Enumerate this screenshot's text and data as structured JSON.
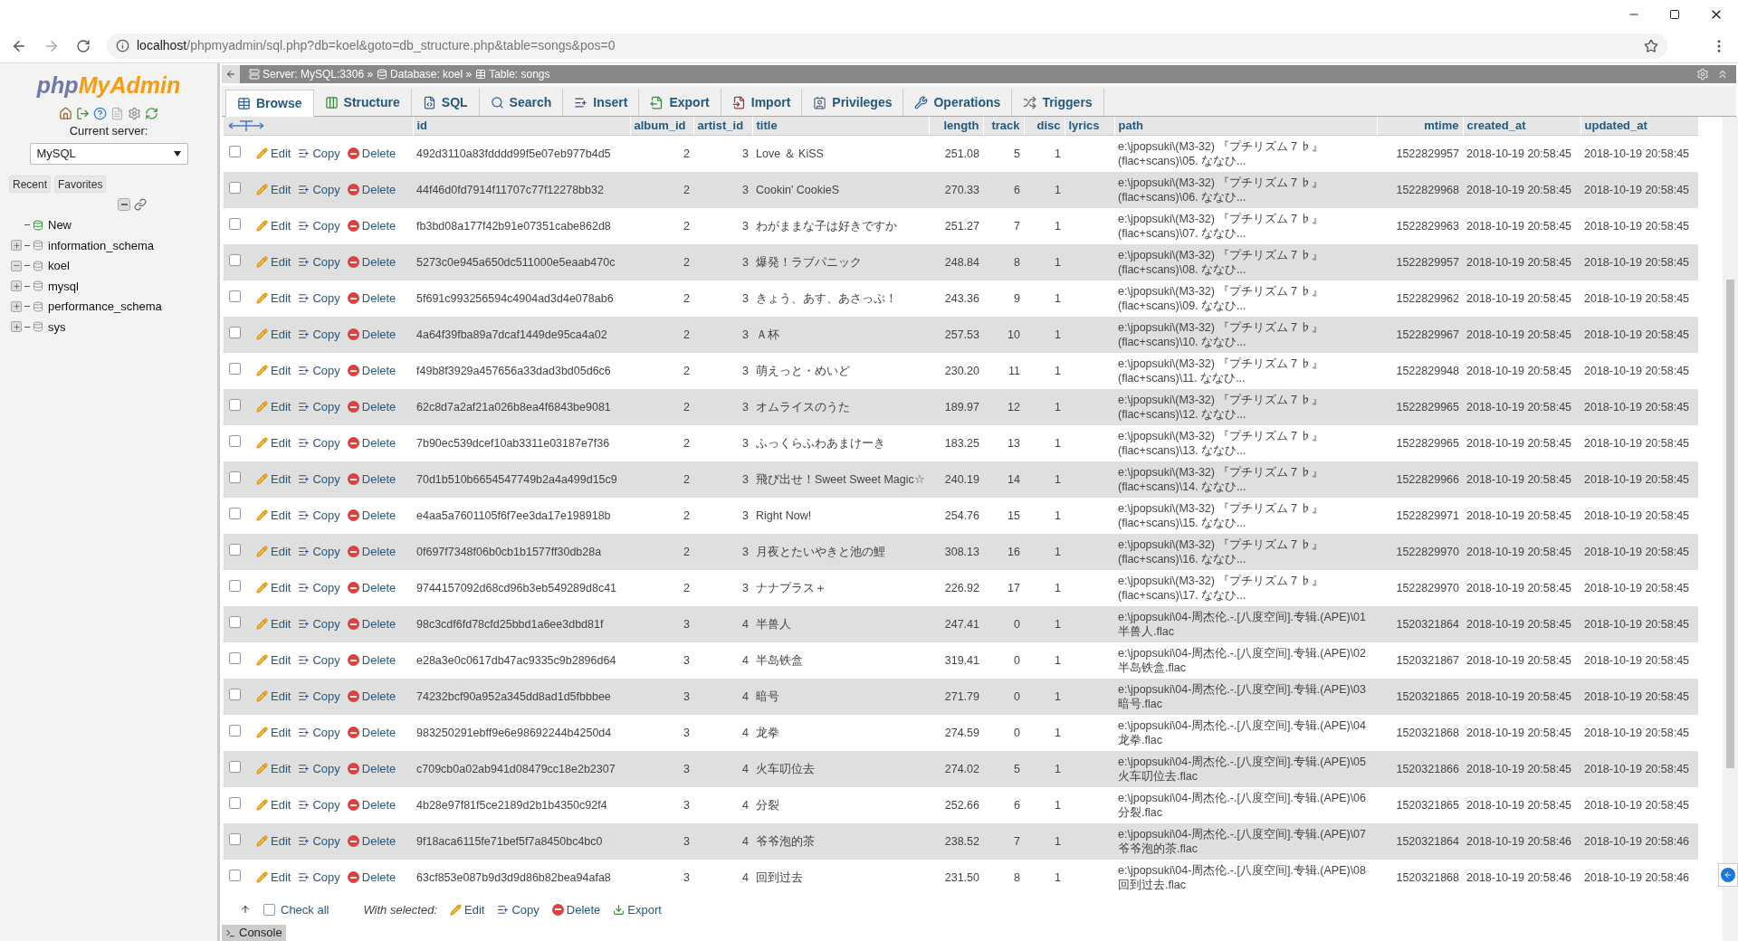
{
  "browser": {
    "url_host": "localhost",
    "url_rest": "/phpmyadmin/sql.php?db=koel&goto=db_structure.php&table=songs&pos=0"
  },
  "sidebar": {
    "logo_a": "php",
    "logo_b": "MyAdmin",
    "server_label": "Current server:",
    "server_value": "MySQL",
    "buttons": [
      "Recent",
      "Favorites"
    ],
    "tree": [
      {
        "kind": "new",
        "label": "New"
      },
      {
        "kind": "db",
        "label": "information_schema",
        "expanded": false
      },
      {
        "kind": "db",
        "label": "koel",
        "expanded": true
      },
      {
        "kind": "db",
        "label": "mysql",
        "expanded": false
      },
      {
        "kind": "db",
        "label": "performance_schema",
        "expanded": false
      },
      {
        "kind": "db",
        "label": "sys",
        "expanded": false
      }
    ]
  },
  "breadcrumb": [
    {
      "kind": "server",
      "label": "Server: MySQL:3306 »"
    },
    {
      "kind": "database",
      "label": "Database: koel »"
    },
    {
      "kind": "table",
      "label": "Table: songs"
    }
  ],
  "tabs": [
    {
      "kind": "browse",
      "label": "Browse",
      "selected": true
    },
    {
      "kind": "structure",
      "label": "Structure",
      "selected": false
    },
    {
      "kind": "sql",
      "label": "SQL",
      "selected": false
    },
    {
      "kind": "search",
      "label": "Search",
      "selected": false
    },
    {
      "kind": "insert",
      "label": "Insert",
      "selected": false
    },
    {
      "kind": "export",
      "label": "Export",
      "selected": false
    },
    {
      "kind": "import",
      "label": "Import",
      "selected": false
    },
    {
      "kind": "privileges",
      "label": "Privileges",
      "selected": false
    },
    {
      "kind": "operations",
      "label": "Operations",
      "selected": false
    },
    {
      "kind": "triggers",
      "label": "Triggers",
      "selected": false
    }
  ],
  "table": {
    "columns": [
      "id",
      "album_id",
      "artist_id",
      "title",
      "length",
      "track",
      "disc",
      "lyrics",
      "path",
      "mtime",
      "created_at",
      "updated_at"
    ],
    "rows": [
      {
        "checked": false,
        "actions": [
          {
            "kind": "edit",
            "label": "Edit"
          },
          {
            "kind": "copy",
            "label": "Copy"
          },
          {
            "kind": "delete",
            "label": "Delete"
          }
        ],
        "id": "492d3110a83fdddd99f5e07eb977b4d5",
        "album_id": "2",
        "artist_id": "3",
        "title": "Love ＆ KiSS",
        "length": "251.08",
        "track": "5",
        "disc": "1",
        "path": "e:\\jpopsuki\\(M3-32) 『プチリズム７♭』(flac+scans)\\05. ななひ...",
        "mtime": "1522829957",
        "created_at": "2018-10-19 20:58:45",
        "updated_at": "2018-10-19 20:58:45"
      },
      {
        "checked": false,
        "actions": [
          {
            "kind": "edit",
            "label": "Edit"
          },
          {
            "kind": "copy",
            "label": "Copy"
          },
          {
            "kind": "delete",
            "label": "Delete"
          }
        ],
        "id": "44f46d0fd7914f11707c77f12278bb32",
        "album_id": "2",
        "artist_id": "3",
        "title": "Cookin' CookieS",
        "length": "270.33",
        "track": "6",
        "disc": "1",
        "path": "e:\\jpopsuki\\(M3-32) 『プチリズム７♭』(flac+scans)\\06. ななひ...",
        "mtime": "1522829968",
        "created_at": "2018-10-19 20:58:45",
        "updated_at": "2018-10-19 20:58:45"
      },
      {
        "checked": false,
        "actions": [
          {
            "kind": "edit",
            "label": "Edit"
          },
          {
            "kind": "copy",
            "label": "Copy"
          },
          {
            "kind": "delete",
            "label": "Delete"
          }
        ],
        "id": "fb3bd08a177f42b91e07351cabe862d8",
        "album_id": "2",
        "artist_id": "3",
        "title": "わがままな子は好きですか",
        "length": "251.27",
        "track": "7",
        "disc": "1",
        "path": "e:\\jpopsuki\\(M3-32) 『プチリズム７♭』(flac+scans)\\07. ななひ...",
        "mtime": "1522829963",
        "created_at": "2018-10-19 20:58:45",
        "updated_at": "2018-10-19 20:58:45"
      },
      {
        "checked": false,
        "actions": [
          {
            "kind": "edit",
            "label": "Edit"
          },
          {
            "kind": "copy",
            "label": "Copy"
          },
          {
            "kind": "delete",
            "label": "Delete"
          }
        ],
        "id": "5273c0e945a650dc511000e5eaab470c",
        "album_id": "2",
        "artist_id": "3",
        "title": "爆発！ラブパニック",
        "length": "248.84",
        "track": "8",
        "disc": "1",
        "path": "e:\\jpopsuki\\(M3-32) 『プチリズム７♭』(flac+scans)\\08. ななひ...",
        "mtime": "1522829957",
        "created_at": "2018-10-19 20:58:45",
        "updated_at": "2018-10-19 20:58:45"
      },
      {
        "checked": false,
        "actions": [
          {
            "kind": "edit",
            "label": "Edit"
          },
          {
            "kind": "copy",
            "label": "Copy"
          },
          {
            "kind": "delete",
            "label": "Delete"
          }
        ],
        "id": "5f691c993256594c4904ad3d4e078ab6",
        "album_id": "2",
        "artist_id": "3",
        "title": "きょう、あす、あさっぷ！",
        "length": "243.36",
        "track": "9",
        "disc": "1",
        "path": "e:\\jpopsuki\\(M3-32) 『プチリズム７♭』(flac+scans)\\09. ななひ...",
        "mtime": "1522829962",
        "created_at": "2018-10-19 20:58:45",
        "updated_at": "2018-10-19 20:58:45"
      },
      {
        "checked": false,
        "actions": [
          {
            "kind": "edit",
            "label": "Edit"
          },
          {
            "kind": "copy",
            "label": "Copy"
          },
          {
            "kind": "delete",
            "label": "Delete"
          }
        ],
        "id": "4a64f39fba89a7dcaf1449de95ca4a02",
        "album_id": "2",
        "artist_id": "3",
        "title": "Ａ杯",
        "length": "257.53",
        "track": "10",
        "disc": "1",
        "path": "e:\\jpopsuki\\(M3-32) 『プチリズム７♭』(flac+scans)\\10. ななひ...",
        "mtime": "1522829967",
        "created_at": "2018-10-19 20:58:45",
        "updated_at": "2018-10-19 20:58:45"
      },
      {
        "checked": false,
        "actions": [
          {
            "kind": "edit",
            "label": "Edit"
          },
          {
            "kind": "copy",
            "label": "Copy"
          },
          {
            "kind": "delete",
            "label": "Delete"
          }
        ],
        "id": "f49b8f3929a457656a33dad3bd05d6c6",
        "album_id": "2",
        "artist_id": "3",
        "title": "萌えっと・めいど",
        "length": "230.20",
        "track": "11",
        "disc": "1",
        "path": "e:\\jpopsuki\\(M3-32) 『プチリズム７♭』(flac+scans)\\11. ななひ...",
        "mtime": "1522829948",
        "created_at": "2018-10-19 20:58:45",
        "updated_at": "2018-10-19 20:58:45"
      },
      {
        "checked": false,
        "actions": [
          {
            "kind": "edit",
            "label": "Edit"
          },
          {
            "kind": "copy",
            "label": "Copy"
          },
          {
            "kind": "delete",
            "label": "Delete"
          }
        ],
        "id": "62c8d7a2af21a026b8ea4f6843be9081",
        "album_id": "2",
        "artist_id": "3",
        "title": "オムライスのうた",
        "length": "189.97",
        "track": "12",
        "disc": "1",
        "path": "e:\\jpopsuki\\(M3-32) 『プチリズム７♭』(flac+scans)\\12. ななひ...",
        "mtime": "1522829965",
        "created_at": "2018-10-19 20:58:45",
        "updated_at": "2018-10-19 20:58:45"
      },
      {
        "checked": false,
        "actions": [
          {
            "kind": "edit",
            "label": "Edit"
          },
          {
            "kind": "copy",
            "label": "Copy"
          },
          {
            "kind": "delete",
            "label": "Delete"
          }
        ],
        "id": "7b90ec539dcef10ab3311e03187e7f36",
        "album_id": "2",
        "artist_id": "3",
        "title": "ふっくらふわあまけーき",
        "length": "183.25",
        "track": "13",
        "disc": "1",
        "path": "e:\\jpopsuki\\(M3-32) 『プチリズム７♭』(flac+scans)\\13. ななひ...",
        "mtime": "1522829965",
        "created_at": "2018-10-19 20:58:45",
        "updated_at": "2018-10-19 20:58:45"
      },
      {
        "checked": false,
        "actions": [
          {
            "kind": "edit",
            "label": "Edit"
          },
          {
            "kind": "copy",
            "label": "Copy"
          },
          {
            "kind": "delete",
            "label": "Delete"
          }
        ],
        "id": "70d1b510b6654547749b2a4a499d15c9",
        "album_id": "2",
        "artist_id": "3",
        "title": "飛び出せ！Sweet Sweet Magic☆",
        "length": "240.19",
        "track": "14",
        "disc": "1",
        "path": "e:\\jpopsuki\\(M3-32) 『プチリズム７♭』(flac+scans)\\14. ななひ...",
        "mtime": "1522829966",
        "created_at": "2018-10-19 20:58:45",
        "updated_at": "2018-10-19 20:58:45"
      },
      {
        "checked": false,
        "actions": [
          {
            "kind": "edit",
            "label": "Edit"
          },
          {
            "kind": "copy",
            "label": "Copy"
          },
          {
            "kind": "delete",
            "label": "Delete"
          }
        ],
        "id": "e4aa5a7601105f6f7ee3da17e198918b",
        "album_id": "2",
        "artist_id": "3",
        "title": "Right Now!",
        "length": "254.76",
        "track": "15",
        "disc": "1",
        "path": "e:\\jpopsuki\\(M3-32) 『プチリズム７♭』(flac+scans)\\15. ななひ...",
        "mtime": "1522829971",
        "created_at": "2018-10-19 20:58:45",
        "updated_at": "2018-10-19 20:58:45"
      },
      {
        "checked": false,
        "actions": [
          {
            "kind": "edit",
            "label": "Edit"
          },
          {
            "kind": "copy",
            "label": "Copy"
          },
          {
            "kind": "delete",
            "label": "Delete"
          }
        ],
        "id": "0f697f7348f06b0cb1b1577ff30db28a",
        "album_id": "2",
        "artist_id": "3",
        "title": "月夜とたいやきと池の鯉",
        "length": "308.13",
        "track": "16",
        "disc": "1",
        "path": "e:\\jpopsuki\\(M3-32) 『プチリズム７♭』(flac+scans)\\16. ななひ...",
        "mtime": "1522829970",
        "created_at": "2018-10-19 20:58:45",
        "updated_at": "2018-10-19 20:58:45"
      },
      {
        "checked": false,
        "actions": [
          {
            "kind": "edit",
            "label": "Edit"
          },
          {
            "kind": "copy",
            "label": "Copy"
          },
          {
            "kind": "delete",
            "label": "Delete"
          }
        ],
        "id": "9744157092d68cd96b3eb549289d8c41",
        "album_id": "2",
        "artist_id": "3",
        "title": "ナナプラス＋",
        "length": "226.92",
        "track": "17",
        "disc": "1",
        "path": "e:\\jpopsuki\\(M3-32) 『プチリズム７♭』(flac+scans)\\17. ななひ...",
        "mtime": "1522829970",
        "created_at": "2018-10-19 20:58:45",
        "updated_at": "2018-10-19 20:58:45"
      },
      {
        "checked": false,
        "actions": [
          {
            "kind": "edit",
            "label": "Edit"
          },
          {
            "kind": "copy",
            "label": "Copy"
          },
          {
            "kind": "delete",
            "label": "Delete"
          }
        ],
        "id": "98c3cdf6fd78cfd25bbd1a6ee3dbd81f",
        "album_id": "3",
        "artist_id": "4",
        "title": "半兽人",
        "length": "247.41",
        "track": "0",
        "disc": "1",
        "path": "e:\\jpopsuki\\04-周杰伦.-.[八度空间].专辑.(APE)\\01半兽人.flac",
        "mtime": "1520321864",
        "created_at": "2018-10-19 20:58:45",
        "updated_at": "2018-10-19 20:58:45"
      },
      {
        "checked": false,
        "actions": [
          {
            "kind": "edit",
            "label": "Edit"
          },
          {
            "kind": "copy",
            "label": "Copy"
          },
          {
            "kind": "delete",
            "label": "Delete"
          }
        ],
        "id": "e28a3e0c0617db47ac9335c9b2896d64",
        "album_id": "3",
        "artist_id": "4",
        "title": "半岛铁盒",
        "length": "319.41",
        "track": "0",
        "disc": "1",
        "path": "e:\\jpopsuki\\04-周杰伦.-.[八度空间].专辑.(APE)\\02半岛铁盒.flac",
        "mtime": "1520321867",
        "created_at": "2018-10-19 20:58:45",
        "updated_at": "2018-10-19 20:58:45"
      },
      {
        "checked": false,
        "actions": [
          {
            "kind": "edit",
            "label": "Edit"
          },
          {
            "kind": "copy",
            "label": "Copy"
          },
          {
            "kind": "delete",
            "label": "Delete"
          }
        ],
        "id": "74232bcf90a952a345dd8ad1d5fbbbee",
        "album_id": "3",
        "artist_id": "4",
        "title": "暗号",
        "length": "271.79",
        "track": "0",
        "disc": "1",
        "path": "e:\\jpopsuki\\04-周杰伦.-.[八度空间].专辑.(APE)\\03暗号.flac",
        "mtime": "1520321865",
        "created_at": "2018-10-19 20:58:45",
        "updated_at": "2018-10-19 20:58:45"
      },
      {
        "checked": false,
        "actions": [
          {
            "kind": "edit",
            "label": "Edit"
          },
          {
            "kind": "copy",
            "label": "Copy"
          },
          {
            "kind": "delete",
            "label": "Delete"
          }
        ],
        "id": "983250291ebff9e6e98692244b4250d4",
        "album_id": "3",
        "artist_id": "4",
        "title": "龙拳",
        "length": "274.59",
        "track": "0",
        "disc": "1",
        "path": "e:\\jpopsuki\\04-周杰伦.-.[八度空间].专辑.(APE)\\04龙拳.flac",
        "mtime": "1520321868",
        "created_at": "2018-10-19 20:58:45",
        "updated_at": "2018-10-19 20:58:45"
      },
      {
        "checked": false,
        "actions": [
          {
            "kind": "edit",
            "label": "Edit"
          },
          {
            "kind": "copy",
            "label": "Copy"
          },
          {
            "kind": "delete",
            "label": "Delete"
          }
        ],
        "id": "c709cb0a02ab941d08479cc18e2b2307",
        "album_id": "3",
        "artist_id": "4",
        "title": "火车叨位去",
        "length": "274.02",
        "track": "5",
        "disc": "1",
        "path": "e:\\jpopsuki\\04-周杰伦.-.[八度空间].专辑.(APE)\\05火车叨位去.flac",
        "mtime": "1520321866",
        "created_at": "2018-10-19 20:58:45",
        "updated_at": "2018-10-19 20:58:45"
      },
      {
        "checked": false,
        "actions": [
          {
            "kind": "edit",
            "label": "Edit"
          },
          {
            "kind": "copy",
            "label": "Copy"
          },
          {
            "kind": "delete",
            "label": "Delete"
          }
        ],
        "id": "4b28e97f81f5ce2189d2b1b4350c92f4",
        "album_id": "3",
        "artist_id": "4",
        "title": "分裂",
        "length": "252.66",
        "track": "6",
        "disc": "1",
        "path": "e:\\jpopsuki\\04-周杰伦.-.[八度空间].专辑.(APE)\\06分裂.flac",
        "mtime": "1520321865",
        "created_at": "2018-10-19 20:58:45",
        "updated_at": "2018-10-19 20:58:45"
      },
      {
        "checked": false,
        "actions": [
          {
            "kind": "edit",
            "label": "Edit"
          },
          {
            "kind": "copy",
            "label": "Copy"
          },
          {
            "kind": "delete",
            "label": "Delete"
          }
        ],
        "id": "9f18aca6115fe71bef5f7a8450bc4bc0",
        "album_id": "3",
        "artist_id": "4",
        "title": "爷爷泡的茶",
        "length": "238.52",
        "track": "7",
        "disc": "1",
        "path": "e:\\jpopsuki\\04-周杰伦.-.[八度空间].专辑.(APE)\\07爷爷泡的茶.flac",
        "mtime": "1520321864",
        "created_at": "2018-10-19 20:58:46",
        "updated_at": "2018-10-19 20:58:46"
      },
      {
        "checked": false,
        "actions": [
          {
            "kind": "edit",
            "label": "Edit"
          },
          {
            "kind": "copy",
            "label": "Copy"
          },
          {
            "kind": "delete",
            "label": "Delete"
          }
        ],
        "id": "63cf853e087b9d3d9d86b82bea94afa8",
        "album_id": "3",
        "artist_id": "4",
        "title": "回到过去",
        "length": "231.50",
        "track": "8",
        "disc": "1",
        "path": "e:\\jpopsuki\\04-周杰伦.-.[八度空间].专辑.(APE)\\08回到过去.flac",
        "mtime": "1520321868",
        "created_at": "2018-10-19 20:58:46",
        "updated_at": "2018-10-19 20:58:46"
      }
    ]
  },
  "footer": {
    "check_all": {
      "label": "Check all",
      "checked": false
    },
    "with_selected": "With selected:",
    "actions": [
      {
        "kind": "edit",
        "label": "Edit"
      },
      {
        "kind": "copy",
        "label": "Copy"
      },
      {
        "kind": "delete",
        "label": "Delete"
      },
      {
        "kind": "export",
        "label": "Export"
      }
    ]
  },
  "console": {
    "label": "Console"
  }
}
